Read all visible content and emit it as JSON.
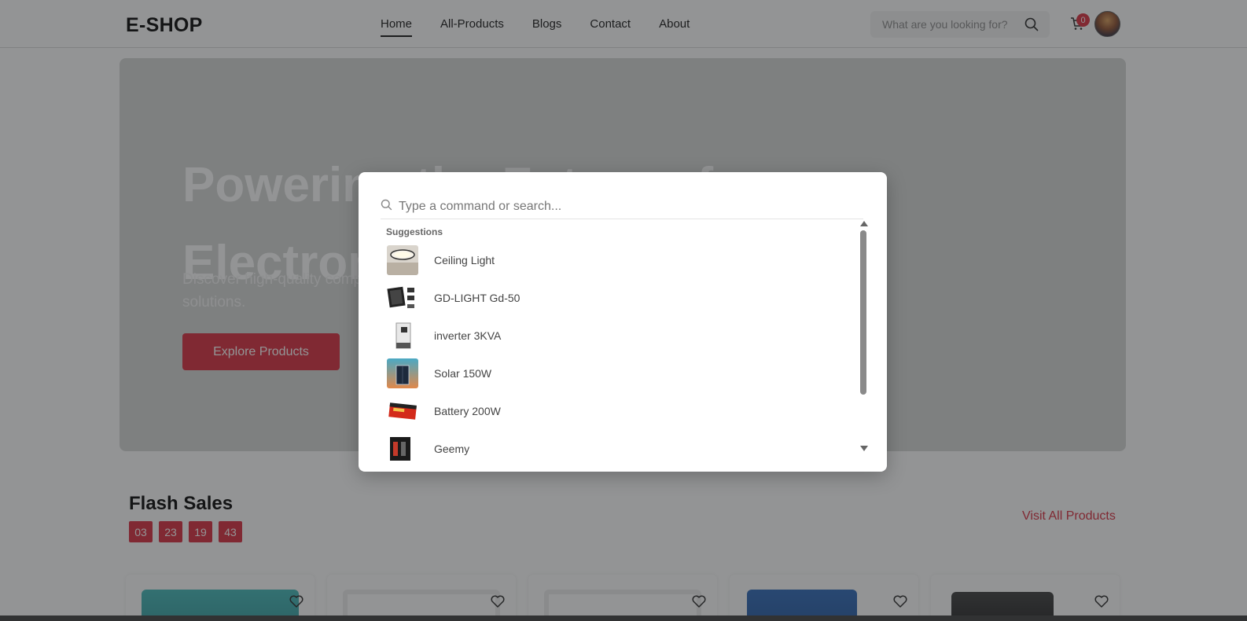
{
  "header": {
    "logo": "E-SHOP",
    "nav": [
      "Home",
      "All-Products",
      "Blogs",
      "Contact",
      "About"
    ],
    "active_nav": "Home",
    "search_placeholder": "What are you looking for?",
    "cart_count": "0"
  },
  "hero": {
    "title": "Powering the Future of Electronics",
    "subtitle": "Discover high-quality components and electronic solutions.",
    "button": "Explore Products"
  },
  "flash_sales": {
    "title": "Flash Sales",
    "countdown": [
      "03",
      "23",
      "19",
      "43"
    ],
    "visit_all": "Visit All Products"
  },
  "command_palette": {
    "placeholder": "Type a command or search...",
    "group_label": "Suggestions",
    "items": [
      {
        "name": "Ceiling Light"
      },
      {
        "name": "GD-LIGHT Gd-50"
      },
      {
        "name": "inverter 3KVA"
      },
      {
        "name": "Solar 150W"
      },
      {
        "name": "Battery 200W"
      },
      {
        "name": "Geemy"
      }
    ]
  },
  "colors": {
    "accent": "#d9283a",
    "overlay": "rgba(40,42,44,0.5)"
  },
  "icons": [
    "search-icon",
    "cart-icon",
    "heart-icon",
    "scroll-up-icon",
    "scroll-down-icon"
  ]
}
